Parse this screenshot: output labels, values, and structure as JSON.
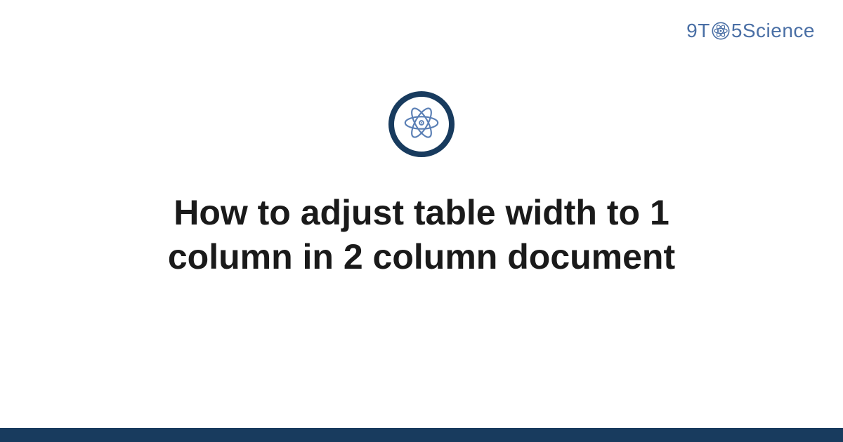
{
  "brand": {
    "part1": "9T",
    "part2": "5Science"
  },
  "title": "How to adjust table width to 1 column in 2 column document",
  "colors": {
    "brand_text": "#4a6fa5",
    "dark_navy": "#183b5e",
    "atom_stroke": "#5a7fb5"
  }
}
